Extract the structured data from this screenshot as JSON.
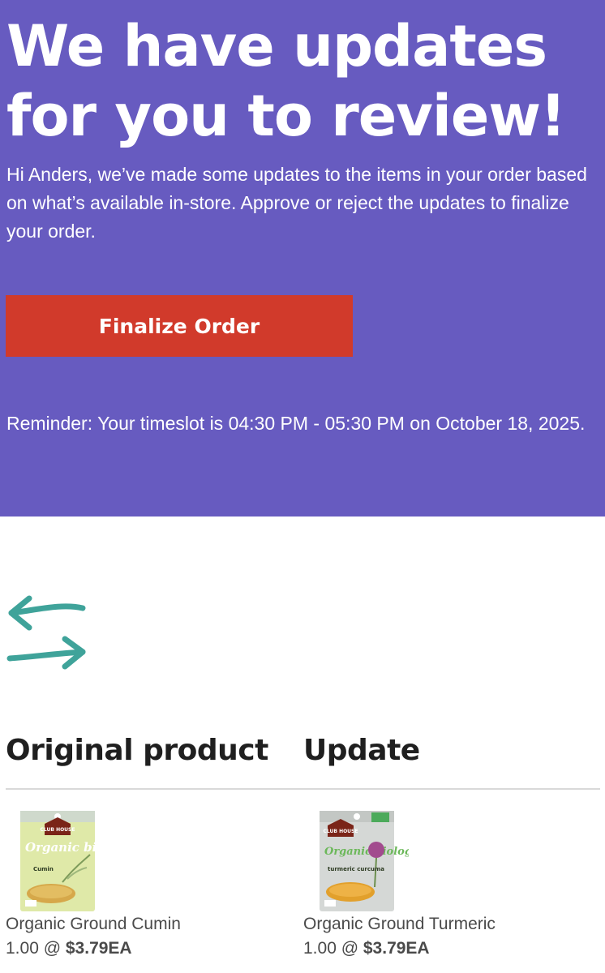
{
  "hero": {
    "title": "We have updates for you to review!",
    "body": "Hi Anders, we’ve made some updates to the items in your order based on what’s available in-store. Approve or reject the updates to finalize your order.",
    "button_label": "Finalize Order",
    "reminder": "Reminder: Your timeslot is 04:30 PM - 05:30 PM on October 18, 2025."
  },
  "swap_icon": "swap-arrows-icon",
  "columns": {
    "original_heading": "Original product",
    "update_heading": "Update"
  },
  "original_product": {
    "image_brand": "CLUB HOUSE",
    "image_label": "Organic biologique",
    "image_spice": "Cumin",
    "name": "Organic Ground Cumin",
    "quantity": "1.00 @",
    "price": "$3.79EA"
  },
  "updated_product": {
    "image_brand": "CLUB HOUSE",
    "image_label": "Organic biologique",
    "image_spice": "turmeric curcuma",
    "name": "Organic Ground Turmeric",
    "quantity": "1.00 @",
    "price": "$3.79EA"
  },
  "colors": {
    "hero_background": "#675bc0",
    "button_background": "#d13a2b",
    "icon_teal": "#3fa39a"
  }
}
